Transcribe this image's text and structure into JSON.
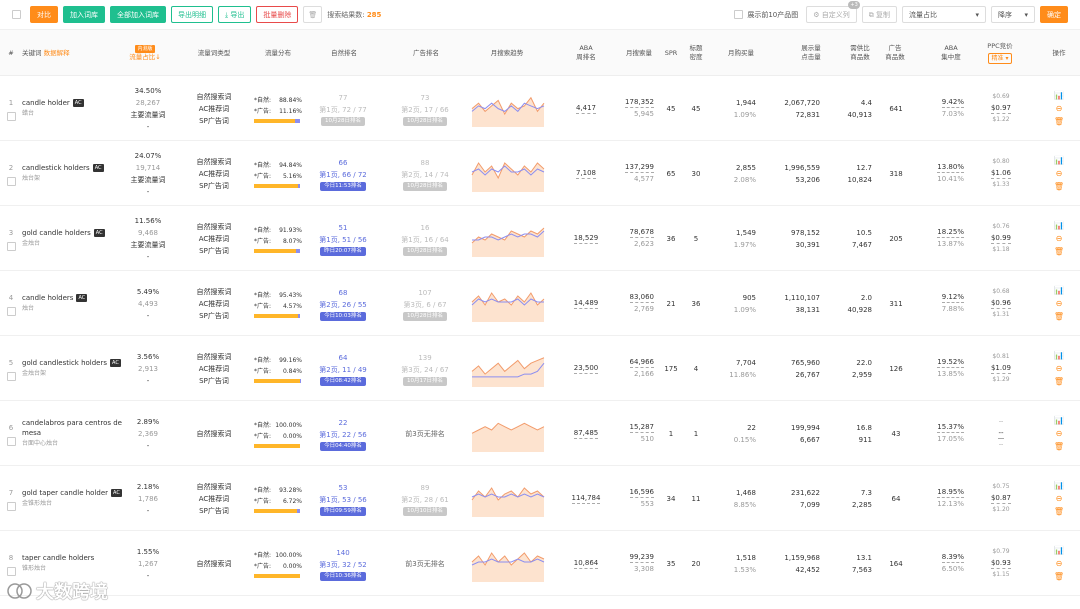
{
  "toolbar": {
    "compare": "对比",
    "add_library": "加入词库",
    "add_all": "全部加入词库",
    "export_detail": "导出明细",
    "export": "导出",
    "batch_delete": "批量删除",
    "result_label": "搜索结果数:",
    "result_count": "285",
    "show_top": "展示前10产品图",
    "custom_cols": "自定义列",
    "replicate": "复制",
    "sort_field": "流量占比",
    "sort_order": "降序",
    "confirm": "确定",
    "custom_badge": "+3"
  },
  "headers": {
    "idx": "#",
    "keyword": "关键词",
    "trans": "数据解释",
    "share_tag": "内测版",
    "share": "流量占比↓",
    "kw_type": "流量词类型",
    "flow": "流量分布",
    "natural": "自然排名",
    "ad": "广告排名",
    "trend": "月搜索趋势",
    "aba": "ABA\n周排名",
    "monthly": "月搜索量",
    "spr": "SPR",
    "title_den": "标题\n密度",
    "monthly_buy": "月购买量",
    "impr": "展示量\n点击量",
    "supply": "需供比\n商品数",
    "ad_count": "广告\n商品数",
    "aba_conc": "ABA\n集中度",
    "ppc": "PPC竞价",
    "ppc_sel": "精准",
    "ops": "操作"
  },
  "rows": [
    {
      "idx": "1",
      "kw": "candle holder",
      "cn": "蜡台",
      "ac": true,
      "share": "34.50%",
      "share_n": "28,267",
      "share_tag": "主要流量词",
      "share_x": "-",
      "types": [
        "自然搜索词",
        "AC推荐词",
        "SP广告词"
      ],
      "nat_pct": "88.84%",
      "ad_pct": "11.16%",
      "ad_frac": 0.1116,
      "nat_top": "77",
      "nat_rank": "第1页, 72 / 77",
      "nat_pill": "10月28日排名",
      "nat_faded": true,
      "ad_top": "73",
      "ad_rank": "第2页, 17 / 66",
      "ad_pill": "10月28日排名",
      "ad_faded": true,
      "aba": "4,417",
      "mv": "178,352",
      "mv2": "5,945",
      "spr": "45",
      "td": "45",
      "mb": "1,944",
      "mb2": "1.09%",
      "im": "2,067,720",
      "im2": "72,831",
      "sp": "4.4",
      "sp2": "40,913",
      "adc": "641",
      "conc": "9.42%",
      "conc2": "7.03%",
      "ppc1": "$0.69",
      "ppc2": "$0.97",
      "ppc3": "$1.22",
      "trend": [
        6,
        8,
        5,
        7,
        9,
        4,
        8,
        6,
        7,
        10,
        5,
        8
      ],
      "trend2": [
        5,
        7,
        6,
        8,
        6,
        5,
        7,
        5,
        8,
        7,
        6,
        7
      ]
    },
    {
      "idx": "2",
      "kw": "candlestick holders",
      "cn": "烛台架",
      "ac": true,
      "share": "24.07%",
      "share_n": "19,714",
      "share_tag": "主要流量词",
      "share_x": "-",
      "types": [
        "自然搜索词",
        "AC推荐词",
        "SP广告词"
      ],
      "nat_pct": "94.84%",
      "ad_pct": "5.16%",
      "ad_frac": 0.0516,
      "nat_top": "66",
      "nat_rank": "第1页, 66 / 72",
      "nat_pill": "今日11:53排名",
      "nat_faded": false,
      "ad_top": "88",
      "ad_rank": "第2页, 14 / 74",
      "ad_pill": "10月28日排名",
      "ad_faded": true,
      "aba": "7,108",
      "mv": "137,299",
      "mv2": "4,577",
      "spr": "65",
      "td": "30",
      "mb": "2,855",
      "mb2": "2.08%",
      "im": "1,996,559",
      "im2": "53,206",
      "sp": "12.7",
      "sp2": "10,824",
      "adc": "318",
      "conc": "13.80%",
      "conc2": "10.41%",
      "ppc1": "$0.80",
      "ppc2": "$1.06",
      "ppc3": "$1.33",
      "trend": [
        5,
        9,
        6,
        8,
        4,
        9,
        7,
        5,
        8,
        6,
        9,
        7
      ],
      "trend2": [
        6,
        7,
        5,
        7,
        6,
        8,
        6,
        6,
        7,
        5,
        7,
        6
      ]
    },
    {
      "idx": "3",
      "kw": "gold candle holders",
      "cn": "金烛台",
      "ac": true,
      "share": "11.56%",
      "share_n": "9,468",
      "share_tag": "主要流量词",
      "share_x": "-",
      "types": [
        "自然搜索词",
        "AC推荐词",
        "SP广告词"
      ],
      "nat_pct": "91.93%",
      "ad_pct": "8.07%",
      "ad_frac": 0.0807,
      "nat_top": "51",
      "nat_rank": "第1页, 51 / 56",
      "nat_pill": "昨日20:07排名",
      "nat_faded": false,
      "ad_top": "16",
      "ad_rank": "第1页, 16 / 64",
      "ad_pill": "10月28日排名",
      "ad_faded": true,
      "aba": "18,529",
      "mv": "78,678",
      "mv2": "2,623",
      "spr": "36",
      "td": "5",
      "mb": "1,549",
      "mb2": "1.97%",
      "im": "978,152",
      "im2": "30,391",
      "sp": "10.5",
      "sp2": "7,467",
      "adc": "205",
      "conc": "18.25%",
      "conc2": "13.87%",
      "ppc1": "$0.76",
      "ppc2": "$0.99",
      "ppc3": "$1.18",
      "trend": [
        4,
        6,
        5,
        7,
        6,
        5,
        8,
        7,
        6,
        8,
        7,
        9
      ],
      "trend2": [
        5,
        5,
        6,
        6,
        5,
        6,
        7,
        6,
        7,
        7,
        6,
        8
      ]
    },
    {
      "idx": "4",
      "kw": "candle holders",
      "cn": "烛台",
      "ac": true,
      "share": "5.49%",
      "share_n": "4,493",
      "share_tag": "-",
      "share_x": "",
      "types": [
        "自然搜索词",
        "AC推荐词",
        "SP广告词"
      ],
      "nat_pct": "95.43%",
      "ad_pct": "4.57%",
      "ad_frac": 0.0457,
      "nat_top": "68",
      "nat_rank": "第2页, 26 / 55",
      "nat_pill": "今日10:03排名",
      "nat_faded": false,
      "ad_top": "107",
      "ad_rank": "第3页, 6 / 67",
      "ad_pill": "10月28日排名",
      "ad_faded": true,
      "aba": "14,489",
      "mv": "83,060",
      "mv2": "2,769",
      "spr": "21",
      "td": "36",
      "mb": "905",
      "mb2": "1.09%",
      "im": "1,110,107",
      "im2": "38,131",
      "sp": "2.0",
      "sp2": "40,928",
      "adc": "311",
      "conc": "9.12%",
      "conc2": "7.88%",
      "ppc1": "$0.68",
      "ppc2": "$0.96",
      "ppc3": "$1.31",
      "trend": [
        6,
        8,
        5,
        9,
        6,
        7,
        5,
        8,
        6,
        9,
        5,
        7
      ],
      "trend2": [
        5,
        7,
        6,
        7,
        6,
        6,
        6,
        7,
        5,
        7,
        6,
        6
      ]
    },
    {
      "idx": "5",
      "kw": "gold candlestick holders",
      "cn": "金烛台架",
      "ac": true,
      "share": "3.56%",
      "share_n": "2,913",
      "share_tag": "-",
      "share_x": "",
      "types": [
        "自然搜索词",
        "AC推荐词",
        "SP广告词"
      ],
      "nat_pct": "99.16%",
      "ad_pct": "0.84%",
      "ad_frac": 0.0084,
      "nat_top": "64",
      "nat_rank": "第2页, 11 / 49",
      "nat_pill": "今日08:42排名",
      "nat_faded": false,
      "ad_top": "139",
      "ad_rank": "第3页, 24 / 67",
      "ad_pill": "10月17日排名",
      "ad_faded": true,
      "aba": "23,500",
      "mv": "64,966",
      "mv2": "2,166",
      "spr": "175",
      "td": "4",
      "mb": "7,704",
      "mb2": "11.86%",
      "im": "765,960",
      "im2": "26,767",
      "sp": "22.0",
      "sp2": "2,959",
      "adc": "126",
      "conc": "19.52%",
      "conc2": "13.85%",
      "ppc1": "$0.81",
      "ppc2": "$1.09",
      "ppc3": "$1.29",
      "trend": [
        5,
        7,
        4,
        6,
        8,
        5,
        7,
        9,
        6,
        8,
        9,
        10
      ],
      "trend2": [
        3,
        3,
        3,
        3,
        3,
        3,
        3,
        3,
        4,
        4,
        5,
        8
      ]
    },
    {
      "idx": "6",
      "kw": "candelabros para centros de mesa",
      "cn": "台面中心烛台",
      "ac": false,
      "share": "2.89%",
      "share_n": "2,369",
      "share_tag": "-",
      "share_x": "",
      "types": [
        "自然搜索词"
      ],
      "nat_pct": "100.00%",
      "ad_pct": "0.00%",
      "ad_frac": 0,
      "nat_top": "22",
      "nat_rank": "第1页, 22 / 56",
      "nat_pill": "今日04:40排名",
      "nat_faded": false,
      "ad_top": "",
      "ad_rank": "前3页无排名",
      "ad_pill": "",
      "ad_faded": false,
      "aba": "87,485",
      "mv": "15,287",
      "mv2": "510",
      "spr": "1",
      "td": "1",
      "mb": "22",
      "mb2": "0.15%",
      "im": "199,994",
      "im2": "6,667",
      "sp": "16.8",
      "sp2": "911",
      "adc": "43",
      "conc": "15.37%",
      "conc2": "17.05%",
      "ppc1": "--",
      "ppc2": "--",
      "ppc3": "--",
      "trend": [
        5,
        6,
        7,
        6,
        8,
        7,
        6,
        7,
        8,
        7,
        6,
        7
      ],
      "trend2": []
    },
    {
      "idx": "7",
      "kw": "gold taper candle holder",
      "cn": "金锥形烛台",
      "ac": true,
      "share": "2.18%",
      "share_n": "1,786",
      "share_tag": "-",
      "share_x": "",
      "types": [
        "自然搜索词",
        "AC推荐词",
        "SP广告词"
      ],
      "nat_pct": "93.28%",
      "ad_pct": "6.72%",
      "ad_frac": 0.0672,
      "nat_top": "53",
      "nat_rank": "第1页, 53 / 56",
      "nat_pill": "昨日09:59排名",
      "nat_faded": false,
      "ad_top": "89",
      "ad_rank": "第2页, 28 / 61",
      "ad_pill": "10月10日排名",
      "ad_faded": true,
      "aba": "114,784",
      "mv": "16,596",
      "mv2": "553",
      "spr": "34",
      "td": "11",
      "mb": "1,468",
      "mb2": "8.85%",
      "im": "231,622",
      "im2": "7,099",
      "sp": "7.3",
      "sp2": "2,285",
      "adc": "64",
      "conc": "18.95%",
      "conc2": "12.13%",
      "ppc1": "$0.75",
      "ppc2": "$0.87",
      "ppc3": "$1.20",
      "trend": [
        5,
        8,
        6,
        9,
        5,
        7,
        8,
        6,
        9,
        7,
        8,
        6
      ],
      "trend2": [
        6,
        7,
        6,
        7,
        6,
        6,
        7,
        6,
        7,
        6,
        7,
        6
      ]
    },
    {
      "idx": "8",
      "kw": "taper candle holders",
      "cn": "锥形烛台",
      "ac": false,
      "share": "1.55%",
      "share_n": "1,267",
      "share_tag": "-",
      "share_x": "",
      "types": [
        "自然搜索词"
      ],
      "nat_pct": "100.00%",
      "ad_pct": "0.00%",
      "ad_frac": 0,
      "nat_top": "140",
      "nat_rank": "第3页, 32 / 52",
      "nat_pill": "今日10:36排名",
      "nat_faded": false,
      "ad_top": "",
      "ad_rank": "前3页无排名",
      "ad_pill": "",
      "ad_faded": false,
      "aba": "10,864",
      "mv": "99,239",
      "mv2": "3,308",
      "spr": "35",
      "td": "20",
      "mb": "1,518",
      "mb2": "1.53%",
      "im": "1,159,968",
      "im2": "42,452",
      "sp": "13.1",
      "sp2": "7,563",
      "adc": "164",
      "conc": "8.39%",
      "conc2": "6.50%",
      "ppc1": "$0.79",
      "ppc2": "$0.93",
      "ppc3": "$1.15",
      "trend": [
        6,
        8,
        5,
        9,
        6,
        8,
        5,
        7,
        9,
        6,
        8,
        7
      ],
      "trend2": [
        5,
        6,
        6,
        7,
        6,
        6,
        6,
        7,
        6,
        6,
        7,
        6
      ]
    }
  ],
  "watermark": "大数跨境",
  "colors": {
    "orange": "#ff8c1a",
    "green": "#1fbf8f",
    "trend_fill": "#fde3cf",
    "trend_line": "#f29b6b",
    "trend_line2": "#8c8ef0",
    "ppc_blue": "#5b6bdc"
  }
}
